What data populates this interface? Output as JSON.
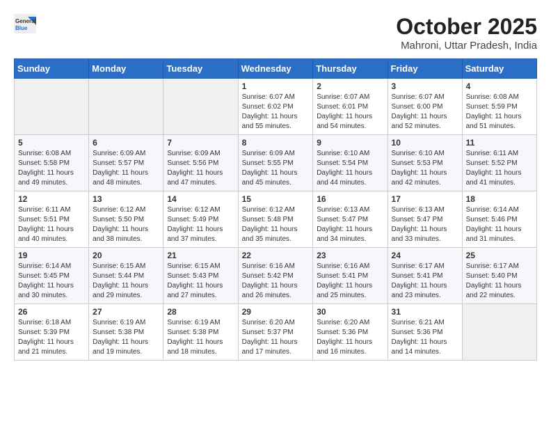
{
  "logo": {
    "line1": "General",
    "line2": "Blue"
  },
  "title": "October 2025",
  "subtitle": "Mahroni, Uttar Pradesh, India",
  "weekdays": [
    "Sunday",
    "Monday",
    "Tuesday",
    "Wednesday",
    "Thursday",
    "Friday",
    "Saturday"
  ],
  "weeks": [
    [
      {
        "day": "",
        "info": ""
      },
      {
        "day": "",
        "info": ""
      },
      {
        "day": "",
        "info": ""
      },
      {
        "day": "1",
        "info": "Sunrise: 6:07 AM\nSunset: 6:02 PM\nDaylight: 11 hours\nand 55 minutes."
      },
      {
        "day": "2",
        "info": "Sunrise: 6:07 AM\nSunset: 6:01 PM\nDaylight: 11 hours\nand 54 minutes."
      },
      {
        "day": "3",
        "info": "Sunrise: 6:07 AM\nSunset: 6:00 PM\nDaylight: 11 hours\nand 52 minutes."
      },
      {
        "day": "4",
        "info": "Sunrise: 6:08 AM\nSunset: 5:59 PM\nDaylight: 11 hours\nand 51 minutes."
      }
    ],
    [
      {
        "day": "5",
        "info": "Sunrise: 6:08 AM\nSunset: 5:58 PM\nDaylight: 11 hours\nand 49 minutes."
      },
      {
        "day": "6",
        "info": "Sunrise: 6:09 AM\nSunset: 5:57 PM\nDaylight: 11 hours\nand 48 minutes."
      },
      {
        "day": "7",
        "info": "Sunrise: 6:09 AM\nSunset: 5:56 PM\nDaylight: 11 hours\nand 47 minutes."
      },
      {
        "day": "8",
        "info": "Sunrise: 6:09 AM\nSunset: 5:55 PM\nDaylight: 11 hours\nand 45 minutes."
      },
      {
        "day": "9",
        "info": "Sunrise: 6:10 AM\nSunset: 5:54 PM\nDaylight: 11 hours\nand 44 minutes."
      },
      {
        "day": "10",
        "info": "Sunrise: 6:10 AM\nSunset: 5:53 PM\nDaylight: 11 hours\nand 42 minutes."
      },
      {
        "day": "11",
        "info": "Sunrise: 6:11 AM\nSunset: 5:52 PM\nDaylight: 11 hours\nand 41 minutes."
      }
    ],
    [
      {
        "day": "12",
        "info": "Sunrise: 6:11 AM\nSunset: 5:51 PM\nDaylight: 11 hours\nand 40 minutes."
      },
      {
        "day": "13",
        "info": "Sunrise: 6:12 AM\nSunset: 5:50 PM\nDaylight: 11 hours\nand 38 minutes."
      },
      {
        "day": "14",
        "info": "Sunrise: 6:12 AM\nSunset: 5:49 PM\nDaylight: 11 hours\nand 37 minutes."
      },
      {
        "day": "15",
        "info": "Sunrise: 6:12 AM\nSunset: 5:48 PM\nDaylight: 11 hours\nand 35 minutes."
      },
      {
        "day": "16",
        "info": "Sunrise: 6:13 AM\nSunset: 5:47 PM\nDaylight: 11 hours\nand 34 minutes."
      },
      {
        "day": "17",
        "info": "Sunrise: 6:13 AM\nSunset: 5:47 PM\nDaylight: 11 hours\nand 33 minutes."
      },
      {
        "day": "18",
        "info": "Sunrise: 6:14 AM\nSunset: 5:46 PM\nDaylight: 11 hours\nand 31 minutes."
      }
    ],
    [
      {
        "day": "19",
        "info": "Sunrise: 6:14 AM\nSunset: 5:45 PM\nDaylight: 11 hours\nand 30 minutes."
      },
      {
        "day": "20",
        "info": "Sunrise: 6:15 AM\nSunset: 5:44 PM\nDaylight: 11 hours\nand 29 minutes."
      },
      {
        "day": "21",
        "info": "Sunrise: 6:15 AM\nSunset: 5:43 PM\nDaylight: 11 hours\nand 27 minutes."
      },
      {
        "day": "22",
        "info": "Sunrise: 6:16 AM\nSunset: 5:42 PM\nDaylight: 11 hours\nand 26 minutes."
      },
      {
        "day": "23",
        "info": "Sunrise: 6:16 AM\nSunset: 5:41 PM\nDaylight: 11 hours\nand 25 minutes."
      },
      {
        "day": "24",
        "info": "Sunrise: 6:17 AM\nSunset: 5:41 PM\nDaylight: 11 hours\nand 23 minutes."
      },
      {
        "day": "25",
        "info": "Sunrise: 6:17 AM\nSunset: 5:40 PM\nDaylight: 11 hours\nand 22 minutes."
      }
    ],
    [
      {
        "day": "26",
        "info": "Sunrise: 6:18 AM\nSunset: 5:39 PM\nDaylight: 11 hours\nand 21 minutes."
      },
      {
        "day": "27",
        "info": "Sunrise: 6:19 AM\nSunset: 5:38 PM\nDaylight: 11 hours\nand 19 minutes."
      },
      {
        "day": "28",
        "info": "Sunrise: 6:19 AM\nSunset: 5:38 PM\nDaylight: 11 hours\nand 18 minutes."
      },
      {
        "day": "29",
        "info": "Sunrise: 6:20 AM\nSunset: 5:37 PM\nDaylight: 11 hours\nand 17 minutes."
      },
      {
        "day": "30",
        "info": "Sunrise: 6:20 AM\nSunset: 5:36 PM\nDaylight: 11 hours\nand 16 minutes."
      },
      {
        "day": "31",
        "info": "Sunrise: 6:21 AM\nSunset: 5:36 PM\nDaylight: 11 hours\nand 14 minutes."
      },
      {
        "day": "",
        "info": ""
      }
    ]
  ]
}
